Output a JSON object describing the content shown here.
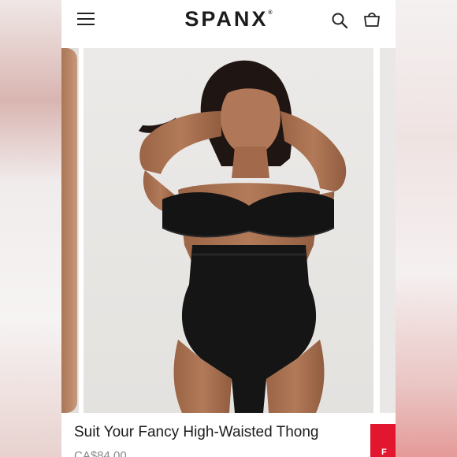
{
  "header": {
    "brand": "SPANX",
    "brand_mark": "®",
    "menu_icon": "hamburger-icon",
    "search_icon": "search-icon",
    "bag_icon": "shopping-bag-icon"
  },
  "product": {
    "title": "Suit Your Fancy High-Waisted Thong",
    "price": "CA$84.00",
    "image_alt": "Model wearing black strapless bra and black high-waisted shaping thong"
  },
  "promo_tab": {
    "label": "F"
  },
  "colors": {
    "accent_red": "#e2162f",
    "text_dark": "#1b1b1b"
  }
}
